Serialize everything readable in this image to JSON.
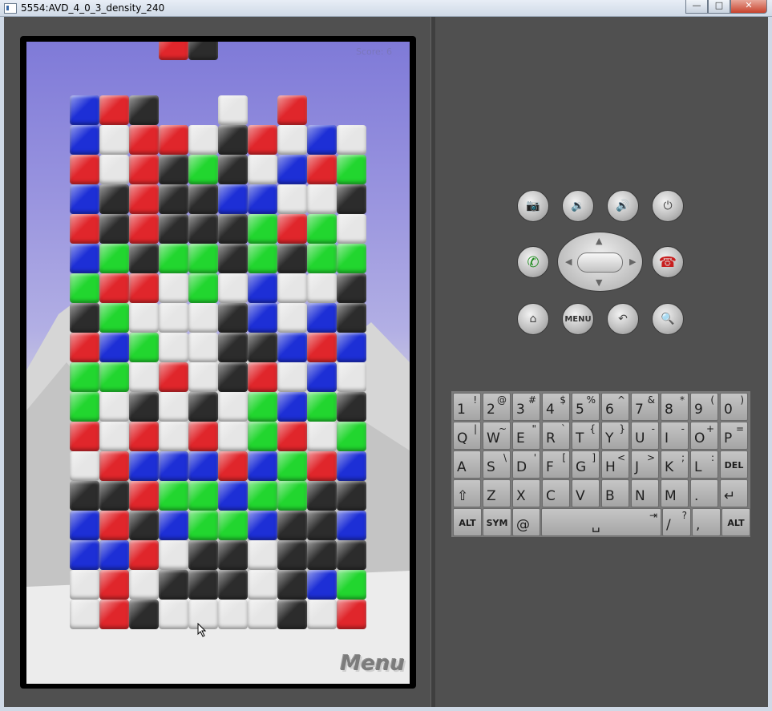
{
  "window": {
    "title": "5554:AVD_4_0_3_density_240",
    "minimize": "—",
    "maximize": "□",
    "close": "✕"
  },
  "game": {
    "score_label": "Score: 6",
    "menu_label": "Menu",
    "colors": {
      "R": "#e0262b",
      "B": "#1d2fd6",
      "G": "#22d62f",
      "K": "#2c2c2c",
      "W": "#e6e6e6"
    },
    "columns": [
      {
        "blocks": "BBRBRBGKRGGRWKBBWW"
      },
      {
        "blocks": "RWWKKGRGBGWWRKRBRR"
      },
      {
        "blocks": "KRRRRKRWGWKRBRKRWK"
      },
      {
        "blocks": "RKKKGWWWRWWBGBWKW"
      },
      {
        "blocks": "WGKKGGWWWKRBGGKKW"
      },
      {
        "blocks": "WKKBKKWKKKWWRBGKKW"
      },
      {
        "blocks": "RWBGGBBKRGGBGBWWW"
      },
      {
        "blocks": "RWBWRKWWBWBRGGKKKK"
      },
      {
        "blocks": "BRWGGWBRBGWRKKKBW"
      },
      {
        "blocks": "WGKWGKKBWKGBKBKGR"
      }
    ],
    "falling": [
      "R",
      "K"
    ]
  },
  "controls": {
    "camera": "camera-icon",
    "vol_down": "volume-down-icon",
    "vol_up": "volume-up-icon",
    "power": "power-icon",
    "call": "call-icon",
    "end_call": "end-call-icon",
    "home": "home-icon",
    "menu_label": "MENU",
    "back": "back-icon",
    "search": "search-icon"
  },
  "keyboard": {
    "row1": [
      [
        "1",
        "!"
      ],
      [
        "2",
        "@"
      ],
      [
        "3",
        "#"
      ],
      [
        "4",
        "$"
      ],
      [
        "5",
        "%"
      ],
      [
        "6",
        "^"
      ],
      [
        "7",
        "&"
      ],
      [
        "8",
        "*"
      ],
      [
        "9",
        "("
      ],
      [
        "0",
        ")"
      ]
    ],
    "row2": [
      [
        "Q",
        "|"
      ],
      [
        "W",
        "~"
      ],
      [
        "E",
        "\""
      ],
      [
        "R",
        "`"
      ],
      [
        "T",
        "{"
      ],
      [
        "Y",
        "}"
      ],
      [
        "U",
        "-"
      ],
      [
        "I",
        "-"
      ],
      [
        "O",
        "+"
      ],
      [
        "P",
        "="
      ]
    ],
    "row3": [
      [
        "A",
        ""
      ],
      [
        "S",
        "\\"
      ],
      [
        "D",
        "'"
      ],
      [
        "F",
        "["
      ],
      [
        "G",
        "]"
      ],
      [
        "H",
        "<"
      ],
      [
        "J",
        ">"
      ],
      [
        "K",
        ";"
      ],
      [
        "L",
        ":"
      ],
      [
        "DEL",
        ""
      ]
    ],
    "row4": [
      [
        "⇧",
        ""
      ],
      [
        "Z",
        ""
      ],
      [
        "X",
        ""
      ],
      [
        "C",
        ""
      ],
      [
        "V",
        ""
      ],
      [
        "B",
        ""
      ],
      [
        "N",
        ""
      ],
      [
        "M",
        ""
      ],
      [
        ".",
        ""
      ],
      [
        "↵",
        ""
      ]
    ],
    "row5": [
      [
        "ALT",
        ""
      ],
      [
        "SYM",
        ""
      ],
      [
        "@",
        ""
      ],
      [
        "␣",
        "⇥"
      ],
      [
        "/",
        "?"
      ],
      [
        ",",
        ""
      ],
      [
        "ALT",
        ""
      ]
    ]
  }
}
